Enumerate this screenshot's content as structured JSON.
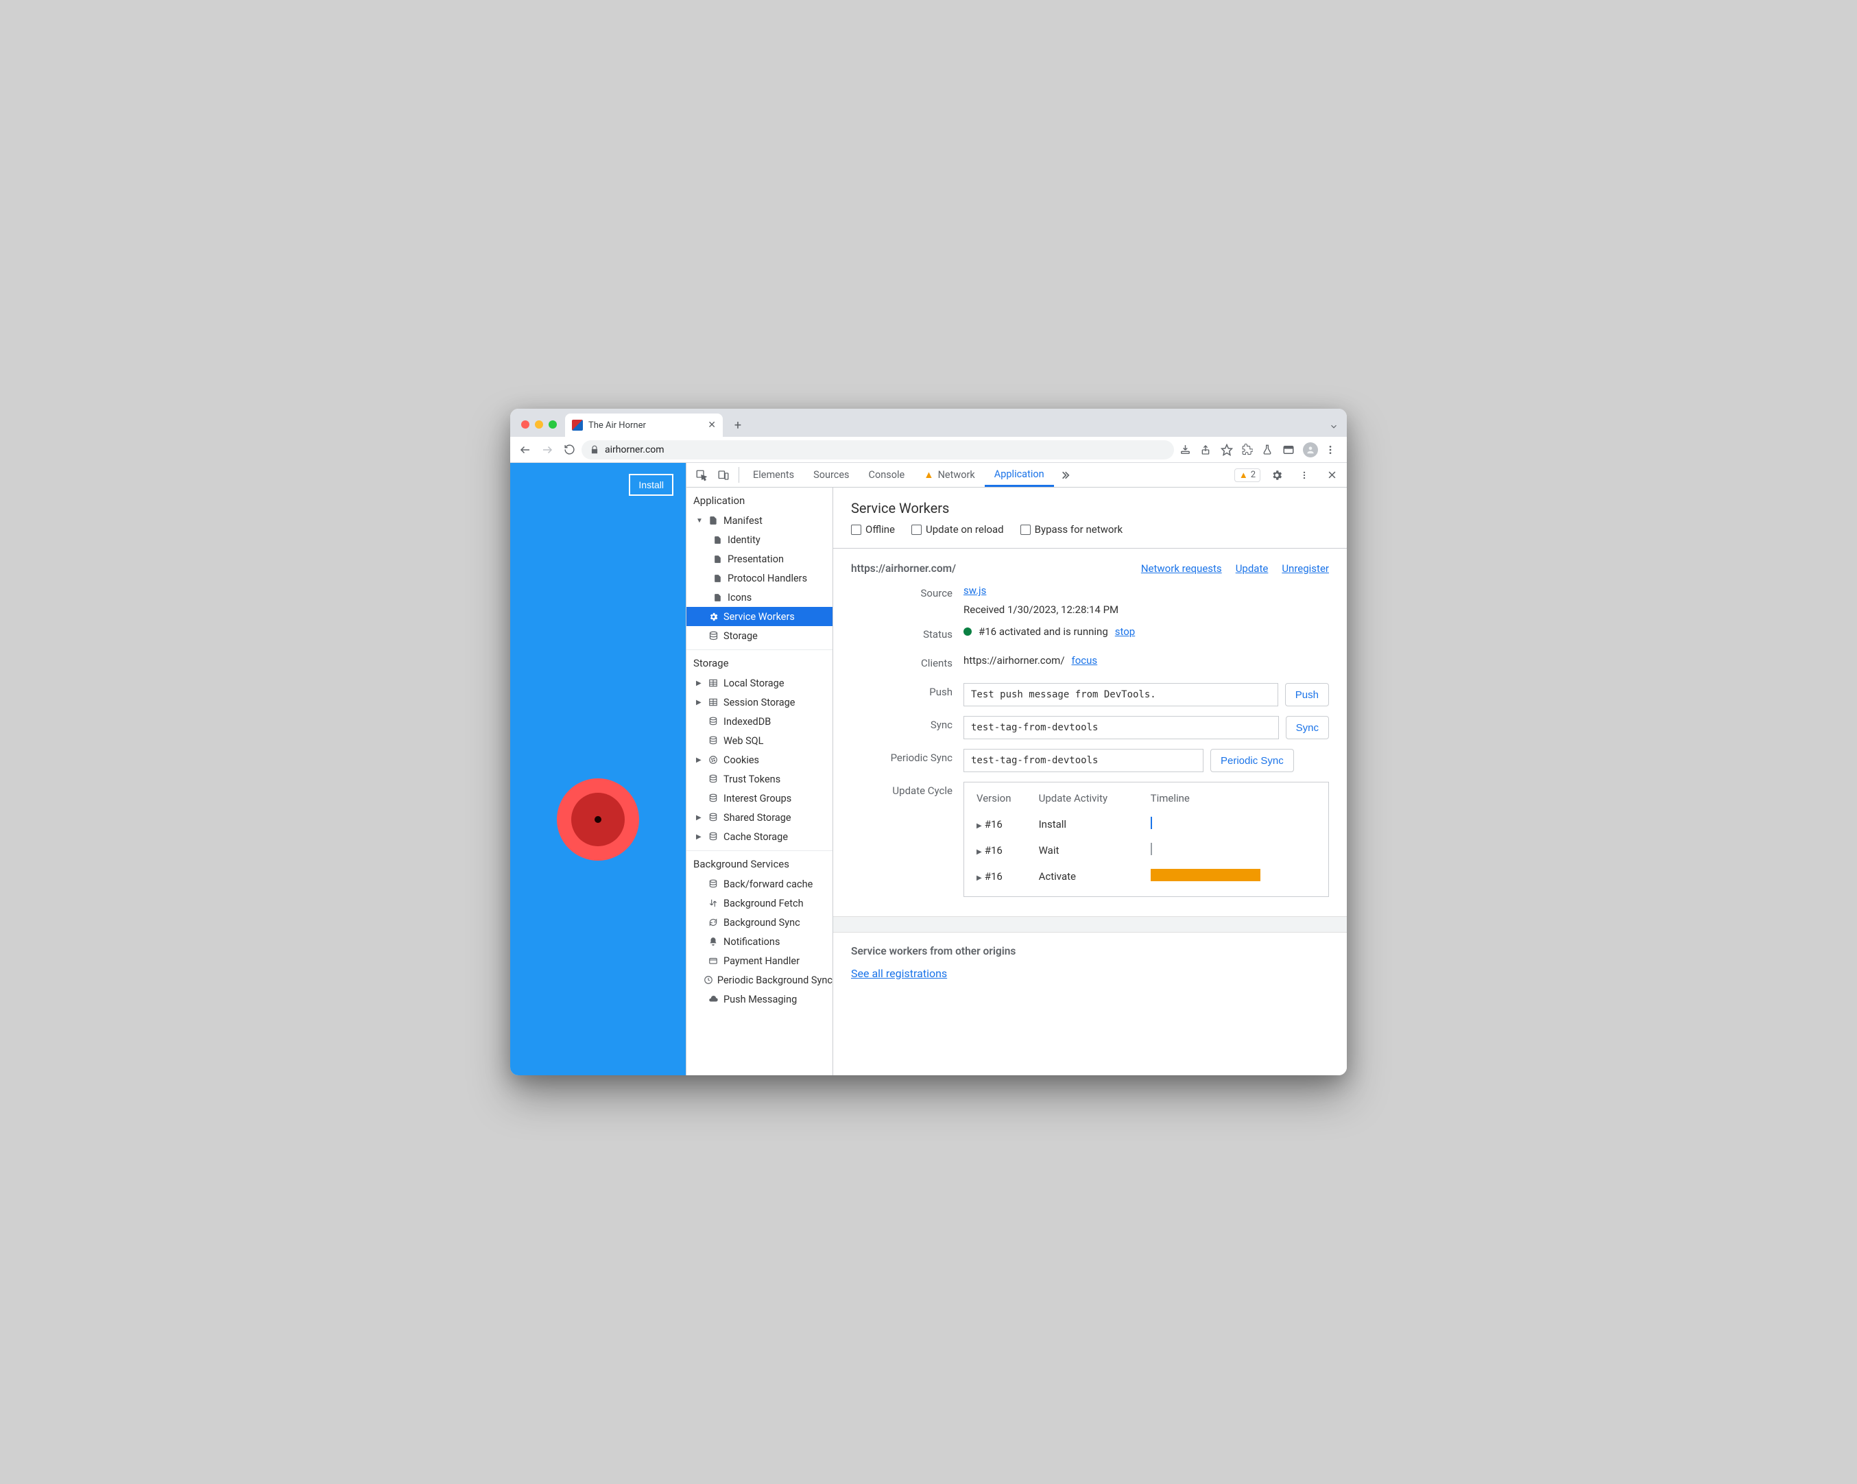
{
  "browser": {
    "tab_title": "The Air Horner",
    "url_display": "airhorner.com"
  },
  "page": {
    "install_label": "Install"
  },
  "devtools": {
    "tabs": {
      "elements": "Elements",
      "sources": "Sources",
      "console": "Console",
      "network": "Network",
      "application": "Application"
    },
    "warn_count": "2",
    "sidebar": {
      "application": {
        "title": "Application",
        "manifest": "Manifest",
        "identity": "Identity",
        "presentation": "Presentation",
        "protocol": "Protocol Handlers",
        "icons": "Icons",
        "sw": "Service Workers",
        "storage_item": "Storage"
      },
      "storage": {
        "title": "Storage",
        "local": "Local Storage",
        "session": "Session Storage",
        "idb": "IndexedDB",
        "websql": "Web SQL",
        "cookies": "Cookies",
        "trust": "Trust Tokens",
        "interest": "Interest Groups",
        "shared": "Shared Storage",
        "cache": "Cache Storage"
      },
      "bg": {
        "title": "Background Services",
        "bf": "Back/forward cache",
        "fetch": "Background Fetch",
        "sync": "Background Sync",
        "notif": "Notifications",
        "pay": "Payment Handler",
        "periodic": "Periodic Background Sync",
        "push": "Push Messaging"
      }
    },
    "sw": {
      "title": "Service Workers",
      "chk_offline": "Offline",
      "chk_reload": "Update on reload",
      "chk_bypass": "Bypass for network",
      "scope": "https://airhorner.com/",
      "link_net": "Network requests",
      "link_update": "Update",
      "link_unreg": "Unregister",
      "labels": {
        "source": "Source",
        "status": "Status",
        "clients": "Clients",
        "push": "Push",
        "sync": "Sync",
        "periodic_sync": "Periodic Sync",
        "cycle": "Update Cycle"
      },
      "source_file": "sw.js",
      "received": "Received 1/30/2023, 12:28:14 PM",
      "status_text": "#16 activated and is running",
      "status_stop": "stop",
      "client_url": "https://airhorner.com/",
      "client_focus": "focus",
      "push_value": "Test push message from DevTools.",
      "push_btn": "Push",
      "sync_value": "test-tag-from-devtools",
      "sync_btn": "Sync",
      "psync_value": "test-tag-from-devtools",
      "psync_btn": "Periodic Sync",
      "cycle_head": {
        "version": "Version",
        "activity": "Update Activity",
        "timeline": "Timeline"
      },
      "cycle_rows": {
        "r1v": "#16",
        "r1a": "Install",
        "r2v": "#16",
        "r2a": "Wait",
        "r3v": "#16",
        "r3a": "Activate"
      },
      "other_title": "Service workers from other origins",
      "other_link": "See all registrations"
    }
  }
}
